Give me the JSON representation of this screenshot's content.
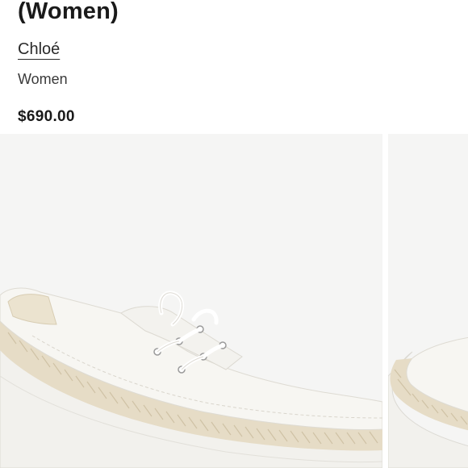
{
  "product": {
    "title": "(Women)",
    "brand": "Chloé",
    "category": "Women",
    "price": "$690.00"
  },
  "gallery": {
    "images": [
      {
        "name": "product-image-main",
        "subject": "white leather sneaker with espadrille rope sole"
      },
      {
        "name": "product-image-next",
        "subject": "white leather sneaker with espadrille rope sole"
      }
    ]
  },
  "colors": {
    "text": "#1a1a1a",
    "image_bg": "#f5f5f4",
    "shoe_white": "#f7f6f2",
    "rope_beige": "#e6dcc6"
  }
}
